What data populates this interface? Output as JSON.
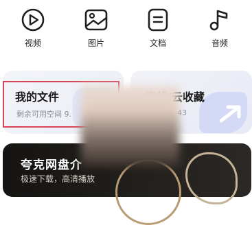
{
  "categories": [
    {
      "label": "视频",
      "icon": "video-icon"
    },
    {
      "label": "图片",
      "icon": "image-icon"
    },
    {
      "label": "文档",
      "icon": "document-icon"
    },
    {
      "label": "音频",
      "icon": "music-icon"
    }
  ],
  "cards": {
    "my_files": {
      "title": "我的文件",
      "subtitle": "剩余可用空间 9."
    },
    "cloud": {
      "title": "离线/云收藏",
      "subtitle": "43"
    }
  },
  "banner": {
    "title": "夸克网盘介",
    "subtitle": "极速下载，高清播放"
  },
  "colors": {
    "highlight": "#d6455a",
    "banner_bg": "#161412"
  }
}
